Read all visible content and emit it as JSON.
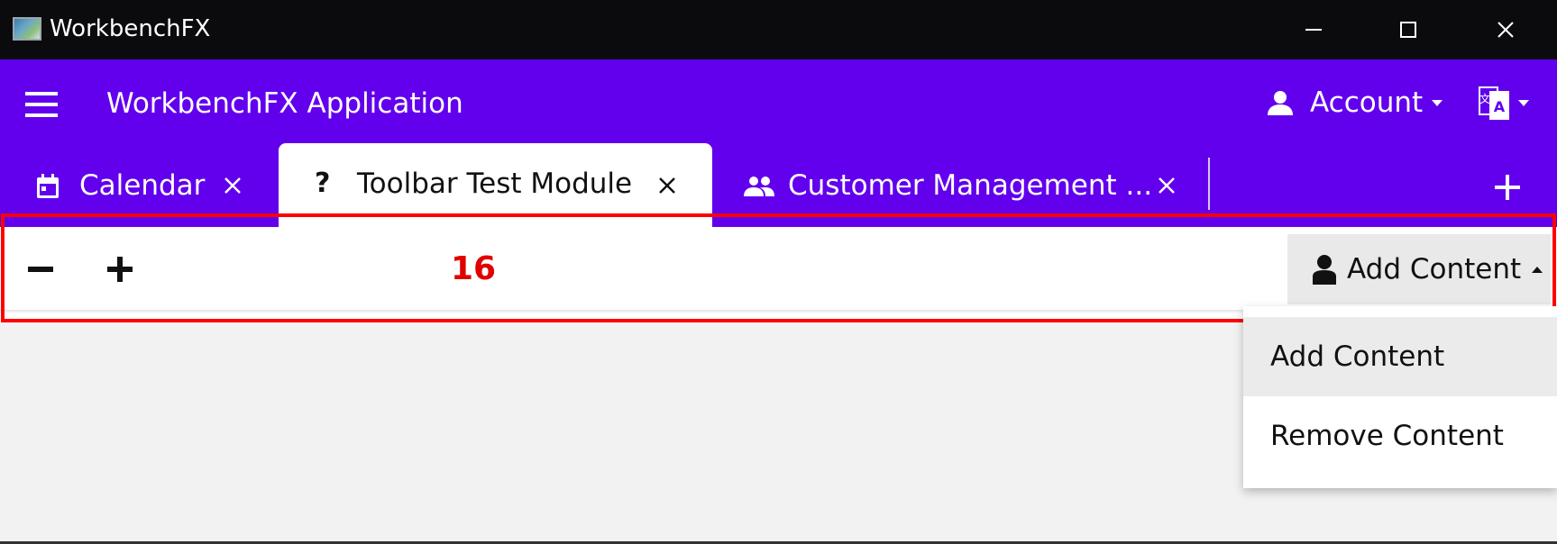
{
  "window": {
    "title": "WorkbenchFX",
    "controls": [
      "minimize-icon",
      "maximize-icon",
      "close-icon"
    ]
  },
  "appbar": {
    "title": "WorkbenchFX Application",
    "account_label": "Account",
    "icons": [
      "menu-icon",
      "person-icon",
      "translate-icon"
    ]
  },
  "tabs": [
    {
      "label": "Calendar",
      "icon": "calendar-icon",
      "active": false
    },
    {
      "label": "Toolbar Test Module",
      "icon": "question-icon",
      "active": true
    },
    {
      "label": "Customer Management ...",
      "icon": "people-icon",
      "active": false
    }
  ],
  "toolbar": {
    "counter": "16",
    "menu_button_label": "Add Content",
    "icons": [
      "minus-icon",
      "plus-icon",
      "user-icon"
    ]
  },
  "dropdown": {
    "items": [
      "Add Content",
      "Remove Content"
    ]
  },
  "colors": {
    "titlebar": "#0b0b0d",
    "accent": "#6200ee",
    "counter": "#e00000",
    "highlight": "#ff0000",
    "content_bg": "#f2f2f2"
  }
}
